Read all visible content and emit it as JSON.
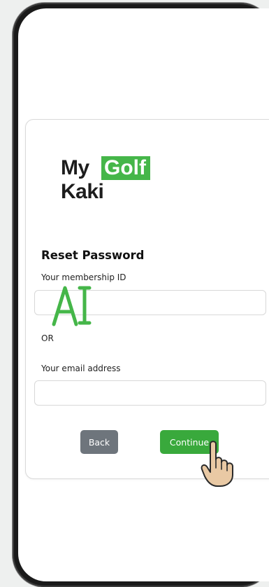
{
  "logo": {
    "word_my": "My",
    "word_golf": "Golf",
    "word_kaki": "Kaki",
    "brand_color": "#45b649"
  },
  "form": {
    "title": "Reset Password",
    "membership_label": "Your membership ID",
    "membership_value": "",
    "or_label": "OR",
    "email_label": "Your email address",
    "email_value": ""
  },
  "buttons": {
    "back_label": "Back",
    "continue_label": "Continue"
  },
  "colors": {
    "continue_bg": "#39a93c",
    "back_bg": "#6e757c"
  }
}
